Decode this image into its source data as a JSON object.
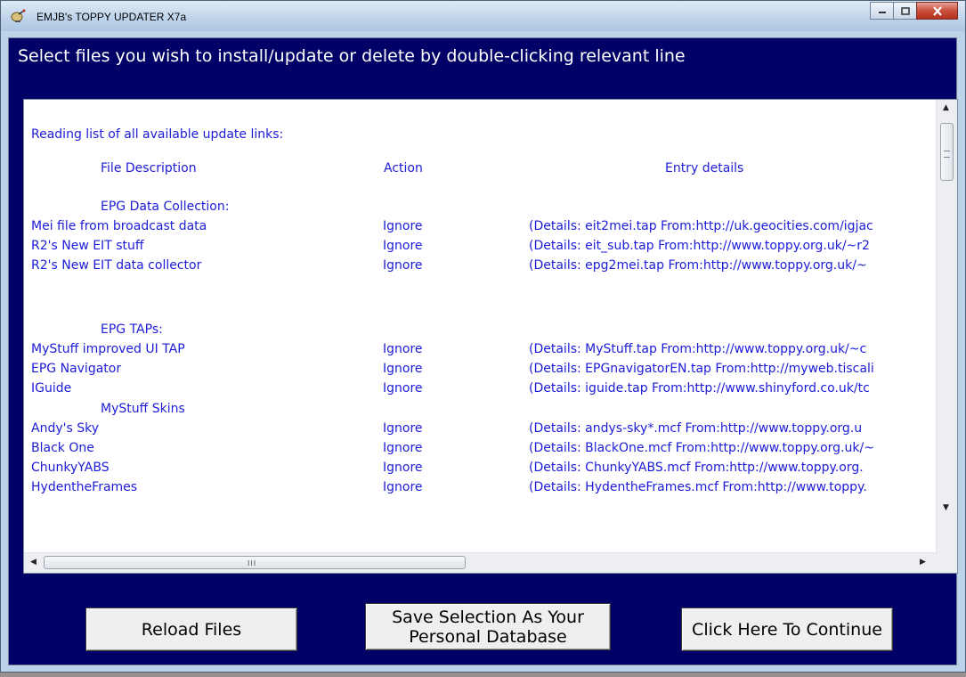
{
  "window": {
    "title": "EMJB's TOPPY UPDATER X7a",
    "close_glyph": "x"
  },
  "heading": "Select files you wish to install/update or delete by double-clicking relevant line",
  "list": {
    "intro": "Reading list of all available update links:",
    "headers": {
      "description": "File Description",
      "action": "Action",
      "details": "Entry details"
    },
    "groups": [
      {
        "label": "EPG Data Collection:",
        "rows": [
          {
            "description": "Mei file from broadcast data",
            "action": "Ignore",
            "details": "(Details: eit2mei.tap From:http://uk.geocities.com/igjac"
          },
          {
            "description": "R2's New EIT stuff",
            "action": "Ignore",
            "details": "(Details: eit_sub.tap From:http://www.toppy.org.uk/~r2"
          },
          {
            "description": "R2's New EIT data collector",
            "action": "Ignore",
            "details": "(Details: epg2mei.tap From:http://www.toppy.org.uk/~"
          }
        ]
      },
      {
        "label": "EPG TAPs:",
        "rows": [
          {
            "description": "MyStuff improved UI TAP",
            "action": "Ignore",
            "details": "(Details: MyStuff.tap From:http://www.toppy.org.uk/~c"
          },
          {
            "description": "EPG Navigator",
            "action": "Ignore",
            "details": "(Details: EPGnavigatorEN.tap From:http://myweb.tiscali"
          },
          {
            "description": "IGuide",
            "action": "Ignore",
            "details": "(Details: iguide.tap From:http://www.shinyford.co.uk/tc"
          }
        ]
      },
      {
        "label": "MyStuff Skins",
        "rows": [
          {
            "description": "Andy's Sky",
            "action": "Ignore",
            "details": "(Details: andys-sky*.mcf From:http://www.toppy.org.u"
          },
          {
            "description": "Black One",
            "action": "Ignore",
            "details": "(Details: BlackOne.mcf From:http://www.toppy.org.uk/~"
          },
          {
            "description": "ChunkyYABS",
            "action": "Ignore",
            "details": "(Details: ChunkyYABS.mcf From:http://www.toppy.org."
          },
          {
            "description": "HydentheFrames",
            "action": "Ignore",
            "details": "(Details: HydentheFrames.mcf From:http://www.toppy."
          }
        ]
      }
    ],
    "scroll_glyphs": {
      "up": "▲",
      "down": "▼",
      "left": "◀",
      "right": "▶",
      "grip": "III"
    }
  },
  "buttons": {
    "reload": "Reload Files",
    "save_line1": "Save Selection As Your",
    "save_line2": "Personal Database",
    "continue": "Click Here To Continue"
  },
  "colors": {
    "client_bg": "#000066",
    "list_text": "#1c1cd8",
    "heading_text": "#ffffff"
  },
  "icons": {
    "app": "satellite-dish-icon",
    "minimize": "minimize-icon",
    "maximize": "maximize-icon",
    "close": "close-icon"
  }
}
